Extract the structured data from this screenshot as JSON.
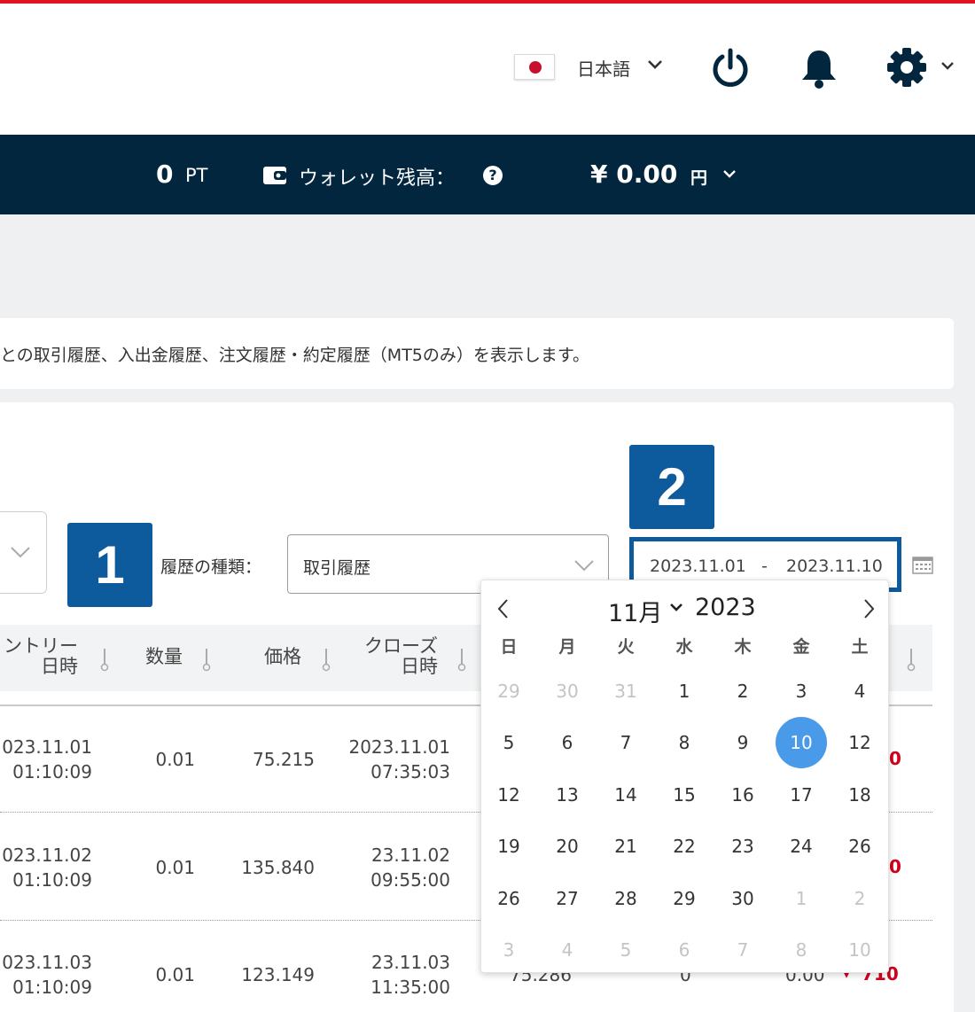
{
  "header": {
    "language": "日本語",
    "icons": [
      "flag-japan-icon",
      "power-icon",
      "bell-icon",
      "gear-icon"
    ],
    "accent_color": "#e0141e"
  },
  "navbar": {
    "points_value": "0",
    "points_unit": "PT",
    "wallet_label": "ウォレット残高：",
    "help_glyph": "?",
    "balance": "¥ 0.00",
    "currency": "円",
    "background_color": "#03263f"
  },
  "info": {
    "text": "との取引履歴、入出金履歴、注文履歴・約定履歴（MT5のみ）を表示します。"
  },
  "filters": {
    "badge1": "1",
    "badge2": "2",
    "type_label": "履歴の種類：",
    "type_value": "取引履歴",
    "date_from": "2023.11.01",
    "date_sep": "-",
    "date_to": "2023.11.10"
  },
  "table": {
    "headers": {
      "entry_line1": "ントリー",
      "entry_line2": "日時",
      "qty": "数量",
      "price": "価格",
      "close_line1": "クローズ",
      "close_line2": "日時"
    },
    "rows": [
      {
        "entry_date": "023.11.01",
        "entry_time": "01:10:09",
        "qty": "0.01",
        "price": "75.215",
        "close_date": "2023.11.01",
        "close_time": "07:35:03",
        "tail": "0"
      },
      {
        "entry_date": "023.11.02",
        "entry_time": "01:10:09",
        "qty": "0.01",
        "price": "135.840",
        "close_date": "23.11.02",
        "close_time": "09:55:00",
        "tail": "0"
      },
      {
        "entry_date": "023.11.03",
        "entry_time": "01:10:09",
        "qty": "0.01",
        "price": "123.149",
        "close_date": "23.11.03",
        "close_time": "11:35:00",
        "tail": "710"
      }
    ],
    "row3_partial": {
      "close_price": "75.286",
      "swap": "0",
      "commission": "0.00",
      "trend_glyph": "▾"
    }
  },
  "calendar": {
    "month": "11月",
    "year": "2023",
    "weekdays": [
      "日",
      "月",
      "火",
      "水",
      "木",
      "金",
      "土"
    ],
    "weeks": [
      [
        {
          "d": "29",
          "m": true
        },
        {
          "d": "30",
          "m": true
        },
        {
          "d": "31",
          "m": true
        },
        {
          "d": "1"
        },
        {
          "d": "2"
        },
        {
          "d": "3"
        },
        {
          "d": "4"
        }
      ],
      [
        {
          "d": "5"
        },
        {
          "d": "6"
        },
        {
          "d": "7"
        },
        {
          "d": "8"
        },
        {
          "d": "9"
        },
        {
          "d": "10",
          "s": true
        },
        {
          "d": "12"
        }
      ],
      [
        {
          "d": "12"
        },
        {
          "d": "13"
        },
        {
          "d": "14"
        },
        {
          "d": "15"
        },
        {
          "d": "16"
        },
        {
          "d": "17"
        },
        {
          "d": "18"
        }
      ],
      [
        {
          "d": "19"
        },
        {
          "d": "20"
        },
        {
          "d": "21"
        },
        {
          "d": "22"
        },
        {
          "d": "23"
        },
        {
          "d": "24"
        },
        {
          "d": "26"
        }
      ],
      [
        {
          "d": "26"
        },
        {
          "d": "27"
        },
        {
          "d": "28"
        },
        {
          "d": "29"
        },
        {
          "d": "30"
        },
        {
          "d": "1",
          "m": true
        },
        {
          "d": "2",
          "m": true
        }
      ],
      [
        {
          "d": "3",
          "m": true
        },
        {
          "d": "4",
          "m": true
        },
        {
          "d": "5",
          "m": true
        },
        {
          "d": "6",
          "m": true
        },
        {
          "d": "7",
          "m": true
        },
        {
          "d": "8",
          "m": true
        },
        {
          "d": "10",
          "m": true
        }
      ]
    ],
    "selected_color": "#4a9aea"
  }
}
